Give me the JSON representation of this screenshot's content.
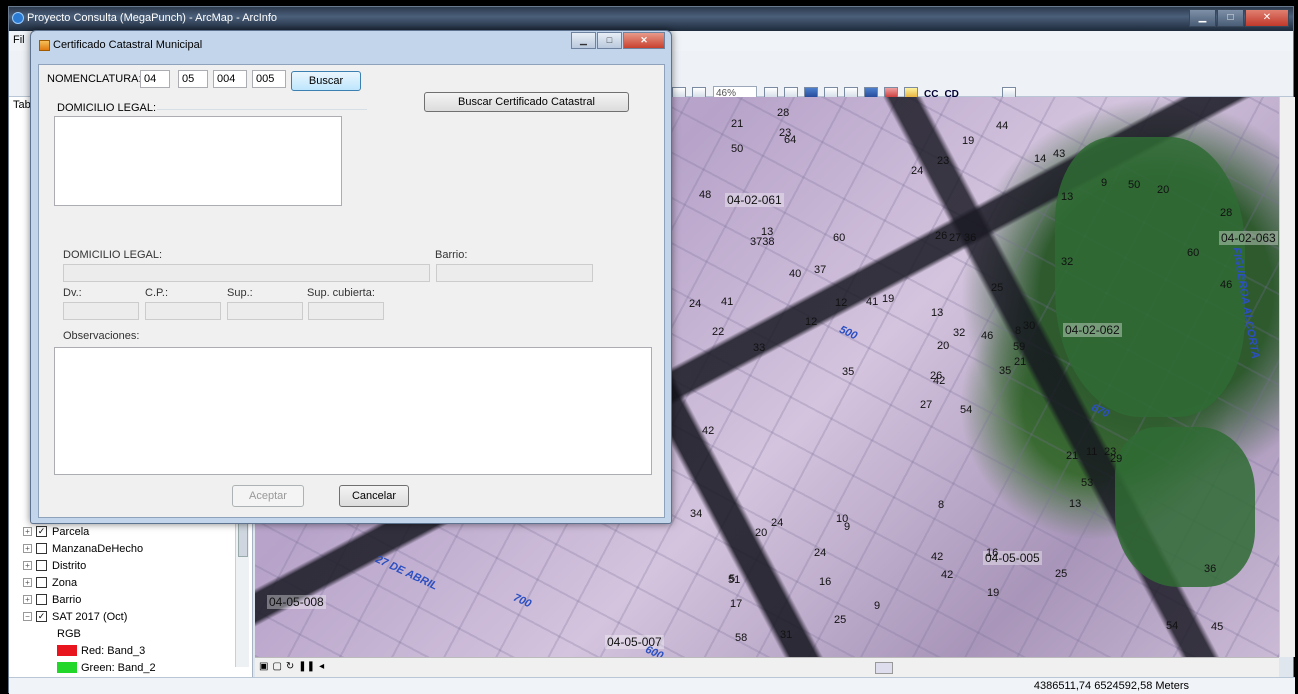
{
  "arcmap": {
    "title": "Proyecto Consulta (MegaPunch) - ArcMap - ArcInfo",
    "menu_first": "Fil",
    "zoom": "46%",
    "cc_label": "CC",
    "cd_label": "CD",
    "toc_tab": "Tab",
    "status_coords": "4386511,74 6524592,58 Meters"
  },
  "toc": {
    "layers": [
      {
        "name": "Parcela",
        "checked": true,
        "expand": "+"
      },
      {
        "name": "ManzanaDeHecho",
        "checked": false,
        "expand": "+"
      },
      {
        "name": "Distrito",
        "checked": false,
        "expand": "+"
      },
      {
        "name": "Zona",
        "checked": false,
        "expand": "+"
      },
      {
        "name": "Barrio",
        "checked": false,
        "expand": "+"
      },
      {
        "name": "SAT 2017 (Oct)",
        "checked": true,
        "expand": "−"
      }
    ],
    "rgb_label": "RGB",
    "bands": [
      {
        "label": "Red:  Band_3",
        "color": "#e8141e"
      },
      {
        "label": "Green: Band_2",
        "color": "#22d62a"
      }
    ]
  },
  "map": {
    "labels": [
      "04-02-061",
      "04-02-063",
      "04-02-062",
      "04-05-005",
      "04-05-008",
      "04-05-007"
    ],
    "numbers": [
      "54",
      "3738",
      "42",
      "5",
      "8",
      "9",
      "43",
      "36",
      "13",
      "35",
      "64",
      "45",
      "33",
      "28",
      "27",
      "32",
      "31",
      "26",
      "25",
      "24",
      "19",
      "17",
      "16",
      "27",
      "30",
      "29",
      "13",
      "23",
      "22",
      "21",
      "46",
      "26",
      "42",
      "20",
      "60",
      "9",
      "10",
      "54",
      "36",
      "23",
      "44",
      "41",
      "12",
      "13",
      "25",
      "24",
      "59",
      "58",
      "42",
      "21",
      "20",
      "60",
      "48",
      "53",
      "25",
      "24",
      "23",
      "21",
      "16",
      "20",
      "19",
      "35",
      "41",
      "37",
      "50",
      "28",
      "14",
      "24",
      "32",
      "34",
      "8",
      "9",
      "11",
      "12",
      "51",
      "50",
      "40",
      "42",
      "13",
      "19",
      "46"
    ],
    "streets": [
      "27 DE ABRIL",
      "700",
      "600",
      "FIGUEROA ALCORTA",
      "500",
      "670"
    ]
  },
  "dialog": {
    "title": "Certificado Catastral Municipal",
    "nomenclatura_label": "NOMENCLATURA:",
    "nom_1": "04",
    "nom_2": "05",
    "nom_3": "004",
    "nom_4": "005",
    "buscar_label": "Buscar",
    "buscar_cert_label": "Buscar Certificado Catastral",
    "domicilio_top_label": "DOMICILIO LEGAL:",
    "domicilio_label": "DOMICILIO LEGAL:",
    "barrio_label": "Barrio:",
    "dv_label": "Dv.:",
    "cp_label": "C.P.:",
    "sup_label": "Sup.:",
    "sup_cubierta_label": "Sup. cubierta:",
    "observaciones_label": "Observaciones:",
    "aceptar_label": "Aceptar",
    "cancelar_label": "Cancelar"
  }
}
